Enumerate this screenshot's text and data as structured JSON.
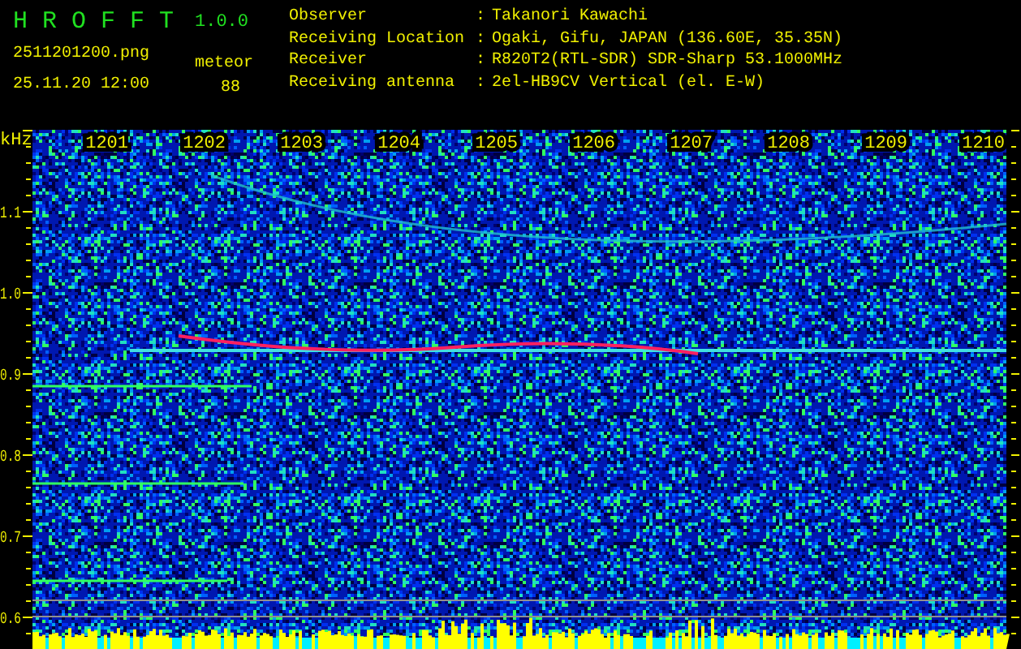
{
  "app": {
    "name": "H R O F F T",
    "version": "1.0.0"
  },
  "file": {
    "name": "2511201200.png",
    "datetime": "25.11.20 12:00"
  },
  "meteor": {
    "label": "meteor",
    "count": "88"
  },
  "info": [
    {
      "label": "Observer",
      "separator": ":",
      "value": "Takanori Kawachi"
    },
    {
      "label": "Receiving Location",
      "separator": ":",
      "value": "Ogaki, Gifu, JAPAN (136.60E, 35.35N)"
    },
    {
      "label": "Receiver",
      "separator": ":",
      "value": "R820T2(RTL-SDR) SDR-Sharp 53.1000MHz"
    },
    {
      "label": "Receiving antenna",
      "separator": ":",
      "value": "2el-HB9CV Vertical (el. E-W)"
    }
  ],
  "spectrogram": {
    "unit": "kHz",
    "y_labels": [
      "1.1",
      "1.0",
      "0.9",
      "0.8",
      "0.7",
      "0.6"
    ],
    "time_labels": [
      "1201",
      "1202",
      "1203",
      "1204",
      "1205",
      "1206",
      "1207",
      "1208",
      "1209",
      "1210"
    ]
  }
}
